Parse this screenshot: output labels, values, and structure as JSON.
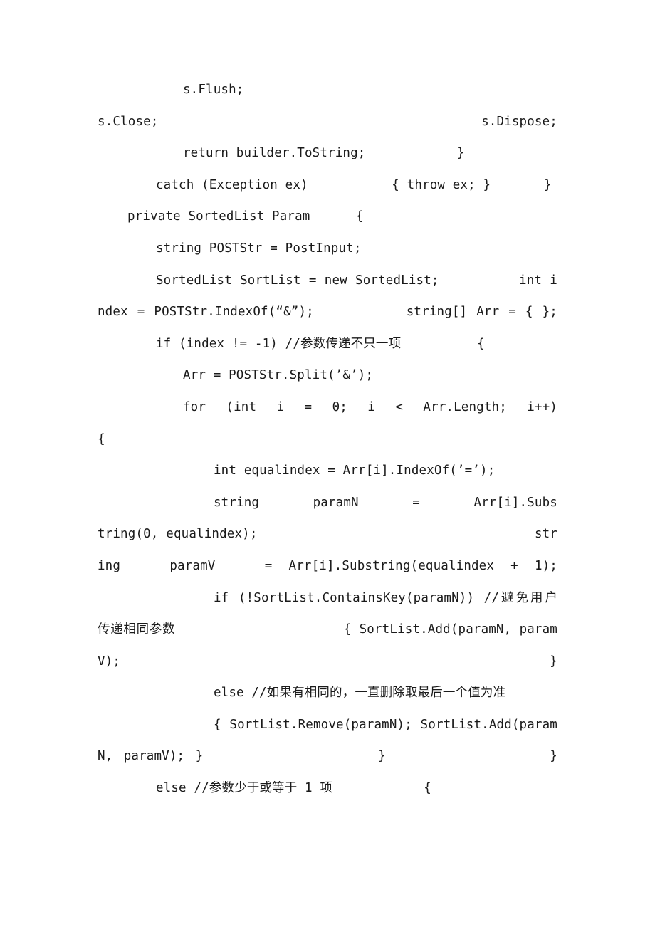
{
  "document": {
    "type": "code-listing",
    "language": "csharp",
    "page_background": "#ffffff",
    "text_color": "#1a1a1a",
    "lines": [
      {
        "id": "line-1",
        "text": "s.Flush;                                               s.Close; s.Dispose;",
        "justified": true
      },
      {
        "id": "line-2",
        "text": "return builder.ToString;            }",
        "justified": false
      },
      {
        "id": "line-3",
        "text": "catch (Exception ex)           { throw ex; }       }",
        "justified": false
      },
      {
        "id": "line-4",
        "text": "private SortedList Param      {",
        "justified": false
      },
      {
        "id": "line-5",
        "text": "string POSTStr = PostInput;",
        "justified": false
      },
      {
        "id": "line-6",
        "text": "SortedList SortList = new SortedList;          int index = POSTStr.IndexOf(“&”);          string[] Arr = { };",
        "justified": true
      },
      {
        "id": "line-7",
        "text": "if (index != -1) //参数传递不只一项          {",
        "justified": false
      },
      {
        "id": "line-8",
        "text": "Arr = POSTStr.Split(’&’);",
        "justified": false
      },
      {
        "id": "line-9",
        "text": "for (int i = 0; i < Arr.Length; i++)                 {",
        "justified": false
      },
      {
        "id": "line-10",
        "text": "int equalindex = Arr[i].IndexOf(’=’);",
        "justified": false
      },
      {
        "id": "line-11",
        "text": "string      paramN      =      Arr[i].Substring(0, equalindex);                            string  paramV  = Arr[i].Substring(equalindex + 1);",
        "justified": true
      },
      {
        "id": "line-12",
        "text": "if (!SortList.ContainsKey(paramN)) //避免用户传递相同参数                  { SortList.Add(paramN, paramV); }",
        "justified": true
      },
      {
        "id": "line-13",
        "text": "else //如果有相同的，一直删除取最后一个值为准",
        "justified": false
      },
      {
        "id": "line-14",
        "text": "{ SortList.Remove(paramN); SortList.Add(paramN, paramV); }              }            }",
        "justified": true
      },
      {
        "id": "line-15",
        "text": "else //参数少于或等于 1 项           {",
        "justified": false
      }
    ],
    "blocks": [
      {
        "name": "block-flush-close-dispose",
        "indent": 120,
        "justified": true,
        "text": "s.Flush;                                                   s.Close; s.Dispose;"
      },
      {
        "name": "block-return-builder",
        "indent": 120,
        "justified": false,
        "text": "return builder.ToString;            }"
      },
      {
        "name": "block-catch-exception",
        "indent": 82,
        "justified": false,
        "text": "catch (Exception ex)           { throw ex; }       }"
      },
      {
        "name": "block-private-sortedlist",
        "indent": 42,
        "justified": false,
        "text": "private SortedList Param      {"
      },
      {
        "name": "block-string-poststr",
        "indent": 82,
        "justified": false,
        "text": "string POSTStr = PostInput;"
      },
      {
        "name": "block-sortlist-new",
        "indent": 82,
        "justified": true,
        "text": "SortedList SortList = new SortedList;          int index = POSTStr.IndexOf(“&”);          string[] Arr = { };"
      },
      {
        "name": "block-if-index",
        "indent": 82,
        "justified": false,
        "text": "if (index != -1) //参数传递不只一项          {"
      },
      {
        "name": "block-arr-split",
        "indent": 120,
        "justified": false,
        "text": "Arr = POSTStr.Split(’&’);"
      },
      {
        "name": "block-for-loop",
        "indent": 120,
        "justified": false,
        "text": "for (int i = 0; i < Arr.Length; i++)                 {"
      },
      {
        "name": "block-int-equalindex",
        "indent": 163,
        "justified": false,
        "text": "int equalindex = Arr[i].IndexOf(’=’);"
      },
      {
        "name": "block-paramn-paramv",
        "indent": 163,
        "justified": true,
        "text": "string       paramN       =       Arr[i].Substring(0, equalindex);                                    string   paramV   = Arr[i].Substring(equalindex + 1);"
      },
      {
        "name": "block-if-containskey",
        "indent": 163,
        "justified": true,
        "text": "if (!SortList.ContainsKey(paramN)) //避免用户传递相同参数                     { SortList.Add(paramN, paramV); }"
      },
      {
        "name": "block-else-comment",
        "indent": 163,
        "justified": false,
        "text": "else //如果有相同的，一直删除取最后一个值为准"
      },
      {
        "name": "block-remove-add",
        "indent": 163,
        "justified": true,
        "text": "{ SortList.Remove(paramN); SortList.Add(paramN, paramV); }                }               }"
      },
      {
        "name": "block-else-lessthan",
        "indent": 82,
        "justified": false,
        "text": "else //参数少于或等于 1 项            {"
      }
    ]
  }
}
